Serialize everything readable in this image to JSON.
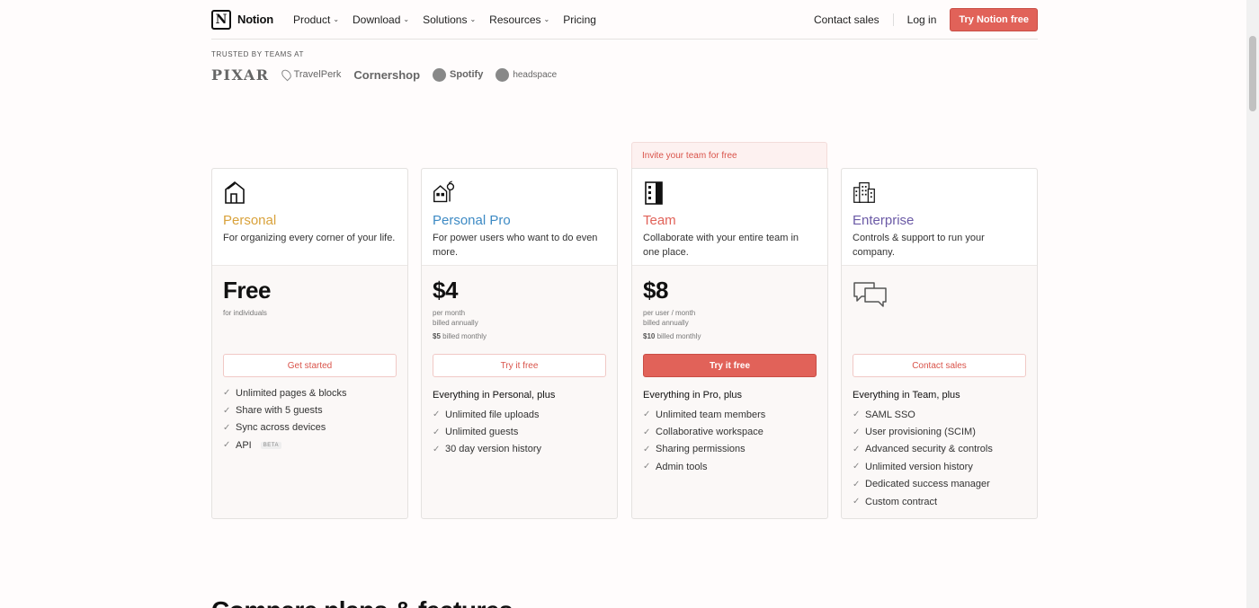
{
  "header": {
    "logo_text": "Notion",
    "nav": [
      {
        "label": "Product",
        "dropdown": true
      },
      {
        "label": "Download",
        "dropdown": true
      },
      {
        "label": "Solutions",
        "dropdown": true
      },
      {
        "label": "Resources",
        "dropdown": true
      },
      {
        "label": "Pricing",
        "dropdown": false
      }
    ],
    "contact_sales": "Contact sales",
    "login": "Log in",
    "try_free": "Try Notion free"
  },
  "trusted": {
    "label": "TRUSTED BY TEAMS AT",
    "brands": [
      "PIXAR",
      "TravelPerk",
      "Cornershop",
      "Spotify",
      "headspace"
    ]
  },
  "invite_banner": "Invite your team for free",
  "plans": [
    {
      "name": "Personal",
      "color": "#d9a23b",
      "desc": "For organizing every corner of your life.",
      "price": "Free",
      "price_sub": [
        "for individuals"
      ],
      "monthly_price": "",
      "monthly_suffix": "",
      "cta": "Get started",
      "features_head": "",
      "features": [
        "Unlimited pages & blocks",
        "Share with 5 guests",
        "Sync across devices",
        "API"
      ],
      "api_badge": "BETA"
    },
    {
      "name": "Personal Pro",
      "color": "#3d8ac4",
      "desc": "For power users who want to do even more.",
      "price": "$4",
      "price_sub": [
        "per month",
        "billed annually"
      ],
      "monthly_price": "$5",
      "monthly_suffix": "billed monthly",
      "cta": "Try it free",
      "features_head": "Everything in Personal, plus",
      "features": [
        "Unlimited file uploads",
        "Unlimited guests",
        "30 day version history"
      ]
    },
    {
      "name": "Team",
      "color": "#e16259",
      "desc": "Collaborate with your entire team in one place.",
      "price": "$8",
      "price_sub": [
        "per user / month",
        "billed annually"
      ],
      "monthly_price": "$10",
      "monthly_suffix": "billed monthly",
      "cta": "Try it free",
      "features_head": "Everything in Pro, plus",
      "features": [
        "Unlimited team members",
        "Collaborative workspace",
        "Sharing permissions",
        "Admin tools"
      ]
    },
    {
      "name": "Enterprise",
      "color": "#6b5aa6",
      "desc": "Controls & support to run your company.",
      "price": "",
      "price_sub": [],
      "monthly_price": "",
      "monthly_suffix": "",
      "cta": "Contact sales",
      "features_head": "Everything in Team, plus",
      "features": [
        "SAML SSO",
        "User provisioning (SCIM)",
        "Advanced security & controls",
        "Unlimited version history",
        "Dedicated success manager",
        "Custom contract"
      ]
    }
  ],
  "compare_title": "Compare plans & features"
}
